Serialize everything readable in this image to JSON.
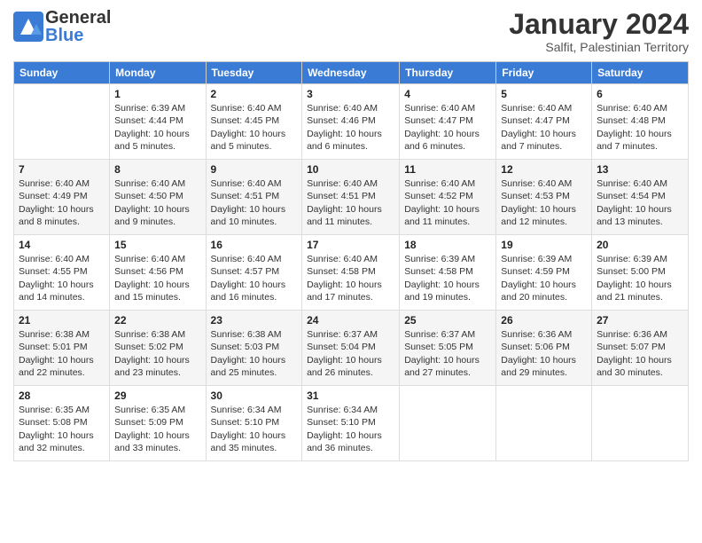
{
  "header": {
    "logo_general": "General",
    "logo_blue": "Blue",
    "title": "January 2024",
    "subtitle": "Salfit, Palestinian Territory"
  },
  "columns": [
    "Sunday",
    "Monday",
    "Tuesday",
    "Wednesday",
    "Thursday",
    "Friday",
    "Saturday"
  ],
  "weeks": [
    [
      {
        "day": "",
        "info": ""
      },
      {
        "day": "1",
        "info": "Sunrise: 6:39 AM\nSunset: 4:44 PM\nDaylight: 10 hours\nand 5 minutes."
      },
      {
        "day": "2",
        "info": "Sunrise: 6:40 AM\nSunset: 4:45 PM\nDaylight: 10 hours\nand 5 minutes."
      },
      {
        "day": "3",
        "info": "Sunrise: 6:40 AM\nSunset: 4:46 PM\nDaylight: 10 hours\nand 6 minutes."
      },
      {
        "day": "4",
        "info": "Sunrise: 6:40 AM\nSunset: 4:47 PM\nDaylight: 10 hours\nand 6 minutes."
      },
      {
        "day": "5",
        "info": "Sunrise: 6:40 AM\nSunset: 4:47 PM\nDaylight: 10 hours\nand 7 minutes."
      },
      {
        "day": "6",
        "info": "Sunrise: 6:40 AM\nSunset: 4:48 PM\nDaylight: 10 hours\nand 7 minutes."
      }
    ],
    [
      {
        "day": "7",
        "info": "Sunrise: 6:40 AM\nSunset: 4:49 PM\nDaylight: 10 hours\nand 8 minutes."
      },
      {
        "day": "8",
        "info": "Sunrise: 6:40 AM\nSunset: 4:50 PM\nDaylight: 10 hours\nand 9 minutes."
      },
      {
        "day": "9",
        "info": "Sunrise: 6:40 AM\nSunset: 4:51 PM\nDaylight: 10 hours\nand 10 minutes."
      },
      {
        "day": "10",
        "info": "Sunrise: 6:40 AM\nSunset: 4:51 PM\nDaylight: 10 hours\nand 11 minutes."
      },
      {
        "day": "11",
        "info": "Sunrise: 6:40 AM\nSunset: 4:52 PM\nDaylight: 10 hours\nand 11 minutes."
      },
      {
        "day": "12",
        "info": "Sunrise: 6:40 AM\nSunset: 4:53 PM\nDaylight: 10 hours\nand 12 minutes."
      },
      {
        "day": "13",
        "info": "Sunrise: 6:40 AM\nSunset: 4:54 PM\nDaylight: 10 hours\nand 13 minutes."
      }
    ],
    [
      {
        "day": "14",
        "info": "Sunrise: 6:40 AM\nSunset: 4:55 PM\nDaylight: 10 hours\nand 14 minutes."
      },
      {
        "day": "15",
        "info": "Sunrise: 6:40 AM\nSunset: 4:56 PM\nDaylight: 10 hours\nand 15 minutes."
      },
      {
        "day": "16",
        "info": "Sunrise: 6:40 AM\nSunset: 4:57 PM\nDaylight: 10 hours\nand 16 minutes."
      },
      {
        "day": "17",
        "info": "Sunrise: 6:40 AM\nSunset: 4:58 PM\nDaylight: 10 hours\nand 17 minutes."
      },
      {
        "day": "18",
        "info": "Sunrise: 6:39 AM\nSunset: 4:58 PM\nDaylight: 10 hours\nand 19 minutes."
      },
      {
        "day": "19",
        "info": "Sunrise: 6:39 AM\nSunset: 4:59 PM\nDaylight: 10 hours\nand 20 minutes."
      },
      {
        "day": "20",
        "info": "Sunrise: 6:39 AM\nSunset: 5:00 PM\nDaylight: 10 hours\nand 21 minutes."
      }
    ],
    [
      {
        "day": "21",
        "info": "Sunrise: 6:38 AM\nSunset: 5:01 PM\nDaylight: 10 hours\nand 22 minutes."
      },
      {
        "day": "22",
        "info": "Sunrise: 6:38 AM\nSunset: 5:02 PM\nDaylight: 10 hours\nand 23 minutes."
      },
      {
        "day": "23",
        "info": "Sunrise: 6:38 AM\nSunset: 5:03 PM\nDaylight: 10 hours\nand 25 minutes."
      },
      {
        "day": "24",
        "info": "Sunrise: 6:37 AM\nSunset: 5:04 PM\nDaylight: 10 hours\nand 26 minutes."
      },
      {
        "day": "25",
        "info": "Sunrise: 6:37 AM\nSunset: 5:05 PM\nDaylight: 10 hours\nand 27 minutes."
      },
      {
        "day": "26",
        "info": "Sunrise: 6:36 AM\nSunset: 5:06 PM\nDaylight: 10 hours\nand 29 minutes."
      },
      {
        "day": "27",
        "info": "Sunrise: 6:36 AM\nSunset: 5:07 PM\nDaylight: 10 hours\nand 30 minutes."
      }
    ],
    [
      {
        "day": "28",
        "info": "Sunrise: 6:35 AM\nSunset: 5:08 PM\nDaylight: 10 hours\nand 32 minutes."
      },
      {
        "day": "29",
        "info": "Sunrise: 6:35 AM\nSunset: 5:09 PM\nDaylight: 10 hours\nand 33 minutes."
      },
      {
        "day": "30",
        "info": "Sunrise: 6:34 AM\nSunset: 5:10 PM\nDaylight: 10 hours\nand 35 minutes."
      },
      {
        "day": "31",
        "info": "Sunrise: 6:34 AM\nSunset: 5:10 PM\nDaylight: 10 hours\nand 36 minutes."
      },
      {
        "day": "",
        "info": ""
      },
      {
        "day": "",
        "info": ""
      },
      {
        "day": "",
        "info": ""
      }
    ]
  ]
}
